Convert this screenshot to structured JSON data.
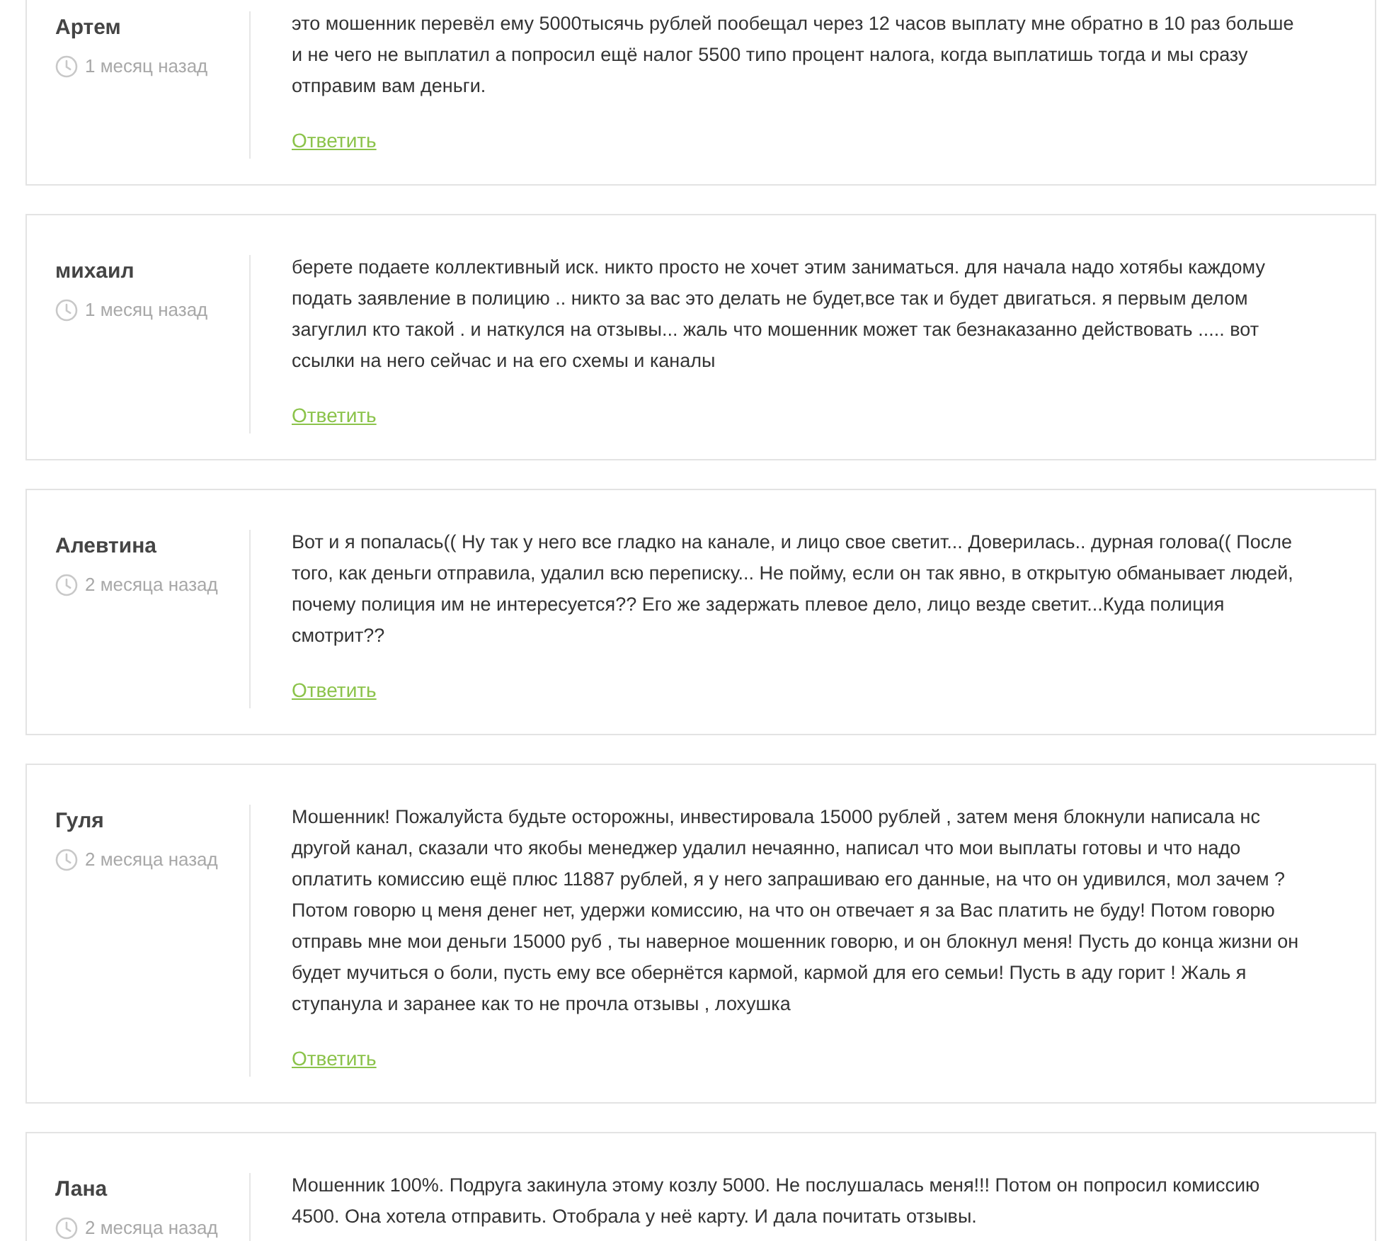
{
  "comments": [
    {
      "author": "Артем",
      "time": "1 месяц назад",
      "text": "это мошенник перевёл ему 5000тысячь рублей пообещал через 12 часов выплату мне обратно в 10 раз больше и не чего не выплатил а попросил ещё налог 5500 типо процент налога, когда выплатишь тогда и мы сразу отправим вам деньги.",
      "reply": "Ответить"
    },
    {
      "author": "михаил",
      "time": "1 месяц назад",
      "text": "берете подаете коллективный иск. никто просто не хочет этим заниматься. для начала надо хотябы каждому подать заявление в полицию .. никто за вас это делать не будет,все так и будет двигаться. я первым делом загуглил кто такой . и наткулся на отзывы... жаль что мошенник может так безнаказанно действовать ..... вот ссылки на него сейчас и на его схемы и каналы",
      "reply": "Ответить"
    },
    {
      "author": "Алевтина",
      "time": "2 месяца назад",
      "text": "Вот и я попалась(( Ну так у него все гладко на канале, и лицо свое светит... Доверилась.. дурная голова(( После того, как деньги отправила, удалил всю переписку... Не пойму, если он так явно, в открытую обманывает людей, почему полиция им не интересуется?? Его же задержать плевое дело, лицо везде светит...Куда полиция смотрит??",
      "reply": "Ответить"
    },
    {
      "author": "Гуля",
      "time": "2 месяца назад",
      "text": "Мошенник! Пожалуйста будьте осторожны, инвестировала 15000 рублей , затем меня блокнули написала нс другой канал, сказали что якобы менеджер удалил нечаянно, написал что мои выплаты готовы и что надо оплатить комиссию ещё плюс 11887 рублей, я у него запрашиваю его данные, на что он удивился, мол зачем ? Потом говорю ц меня денег нет, удержи комиссию, на что он отвечает я за Вас платить не буду! Потом говорю отправь мне мои деньги 15000 руб , ты наверное мошенник говорю, и он блокнул меня! Пусть до конца жизни он будет мучиться о боли, пусть ему все обернётся кармой, кармой для его семьи! Пусть в аду горит ! Жаль я ступанула и заранее как то не прочла отзывы , лохушка",
      "reply": "Ответить"
    },
    {
      "author": "Лана",
      "time": "2 месяца назад",
      "text": "Мошенник 100%. Подруга закинула этому козлу 5000. Не послушалась меня!!! Потом он попросил комиссию 4500. Она хотела отправить. Отобрала у неё карту. И дала почитать отзывы."
    }
  ]
}
